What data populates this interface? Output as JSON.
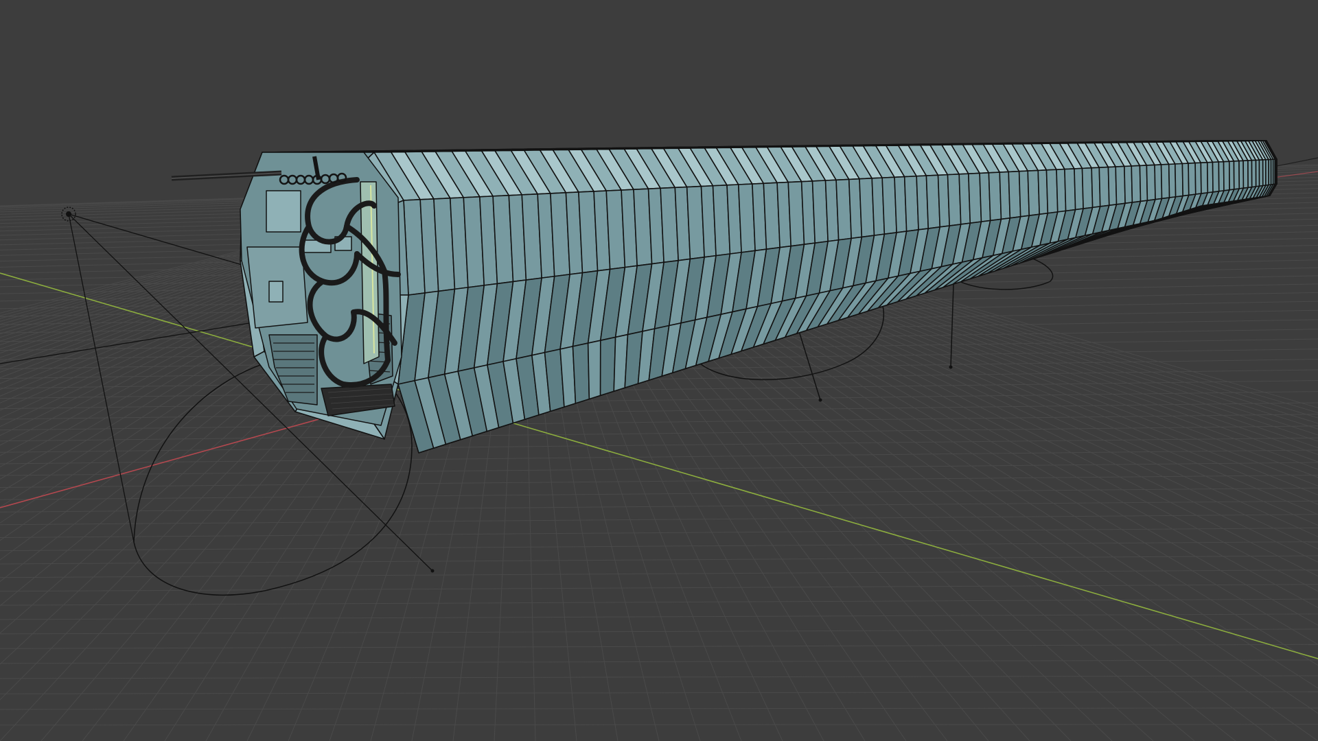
{
  "viewport": {
    "mode": "solid-shading-wireframe-overlay",
    "shown_elements": [
      "floor-grid",
      "x-axis-line",
      "y-axis-line",
      "camera-object",
      "corridor-mesh",
      "curve-objects"
    ]
  },
  "colors": {
    "background": "#3d3d3d",
    "grid_line": "#4a4a4a",
    "x_axis": "#b4484f",
    "y_axis": "#8cad3e",
    "mesh_face": "#779aa0",
    "mesh_face_light": "#8fb1b6",
    "mesh_face_dark": "#5d7e84",
    "mesh_edge": "#111111",
    "curve": "#111111",
    "frame_ring": "#1a1a1a"
  }
}
